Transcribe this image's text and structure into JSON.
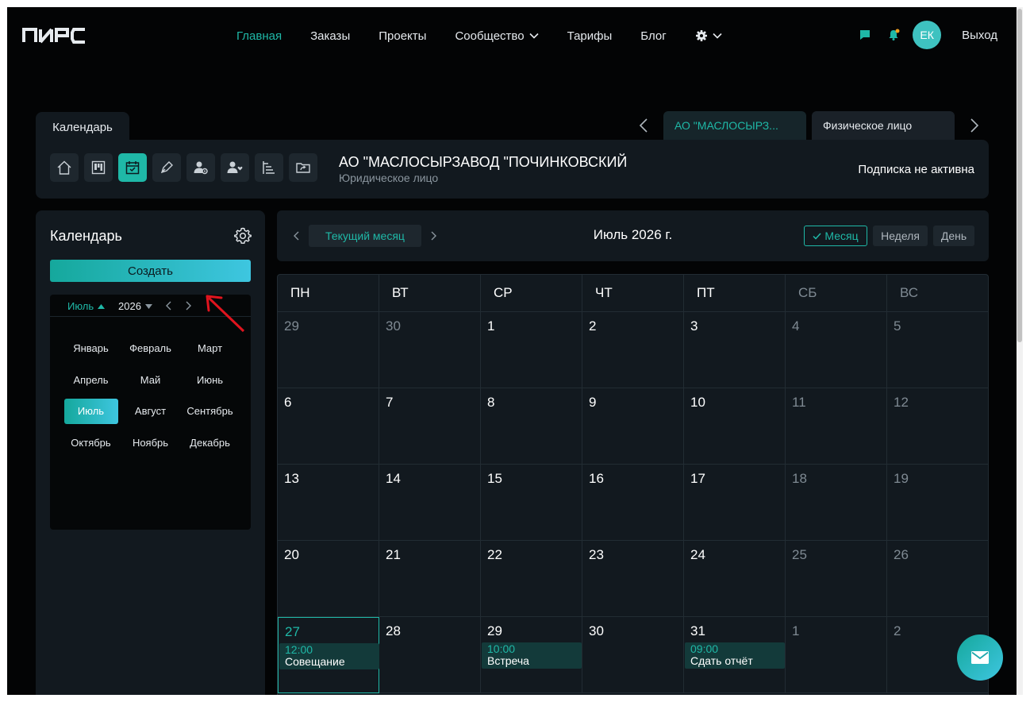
{
  "header": {
    "logo": "ПИРС",
    "nav": [
      {
        "label": "Главная",
        "active": true
      },
      {
        "label": "Заказы"
      },
      {
        "label": "Проекты"
      },
      {
        "label": "Сообщество",
        "dropdown": true
      },
      {
        "label": "Тарифы"
      },
      {
        "label": "Блог"
      }
    ],
    "avatar_initials": "ЕК",
    "logout_label": "Выход",
    "colors": {
      "accent": "#1fb8a7",
      "notification_dot": "#f0a020"
    }
  },
  "tabs": {
    "calendar_tab": "Календарь",
    "companies": [
      {
        "label": "АО \"МАСЛОСЫРЗ...",
        "active": true
      },
      {
        "label": "Физическое лицо",
        "active": false
      }
    ]
  },
  "org": {
    "name": "АО \"МАСЛОСЫРЗАВОД \"ПОЧИНКОВСКИЙ",
    "type": "Юридическое лицо",
    "subscription_status": "Подписка не активна",
    "tools": [
      "home-icon",
      "board-icon",
      "calendar-icon",
      "pen-icon",
      "user-settings-icon",
      "user-heart-icon",
      "tree-list-icon",
      "folder-share-icon"
    ],
    "active_tool": "calendar-icon"
  },
  "sidebar": {
    "title": "Календарь",
    "create_label": "Создать",
    "picker": {
      "month": "Июль",
      "year": "2026",
      "months": [
        "Январь",
        "Февраль",
        "Март",
        "Апрель",
        "Май",
        "Июнь",
        "Июль",
        "Август",
        "Сентябрь",
        "Октябрь",
        "Ноябрь",
        "Декабрь"
      ],
      "selected": "Июль"
    }
  },
  "calendar": {
    "current_month_label": "Текущий месяц",
    "title": "Июль 2026 г.",
    "views": [
      {
        "label": "Месяц",
        "active": true
      },
      {
        "label": "Неделя",
        "active": false
      },
      {
        "label": "День",
        "active": false
      }
    ],
    "weekdays": [
      "ПН",
      "ВТ",
      "СР",
      "ЧТ",
      "ПТ",
      "СБ",
      "ВС"
    ],
    "weeks": [
      [
        {
          "d": "29",
          "other": true
        },
        {
          "d": "30",
          "other": true
        },
        {
          "d": "1"
        },
        {
          "d": "2"
        },
        {
          "d": "3"
        },
        {
          "d": "4",
          "weekend": true
        },
        {
          "d": "5",
          "weekend": true
        }
      ],
      [
        {
          "d": "6"
        },
        {
          "d": "7"
        },
        {
          "d": "8"
        },
        {
          "d": "9"
        },
        {
          "d": "10"
        },
        {
          "d": "11",
          "weekend": true
        },
        {
          "d": "12",
          "weekend": true
        }
      ],
      [
        {
          "d": "13"
        },
        {
          "d": "14"
        },
        {
          "d": "15"
        },
        {
          "d": "16"
        },
        {
          "d": "17"
        },
        {
          "d": "18",
          "weekend": true
        },
        {
          "d": "19",
          "weekend": true
        }
      ],
      [
        {
          "d": "20"
        },
        {
          "d": "21"
        },
        {
          "d": "22"
        },
        {
          "d": "23"
        },
        {
          "d": "24"
        },
        {
          "d": "25",
          "weekend": true
        },
        {
          "d": "26",
          "weekend": true
        }
      ],
      [
        {
          "d": "27",
          "today": true,
          "event": {
            "time": "12:00",
            "title": "Совещание"
          }
        },
        {
          "d": "28"
        },
        {
          "d": "29",
          "event": {
            "time": "10:00",
            "title": "Встреча"
          }
        },
        {
          "d": "30"
        },
        {
          "d": "31",
          "event": {
            "time": "09:00",
            "title": "Сдать отчёт"
          }
        },
        {
          "d": "1",
          "other": true
        },
        {
          "d": "2",
          "other": true
        }
      ]
    ]
  }
}
